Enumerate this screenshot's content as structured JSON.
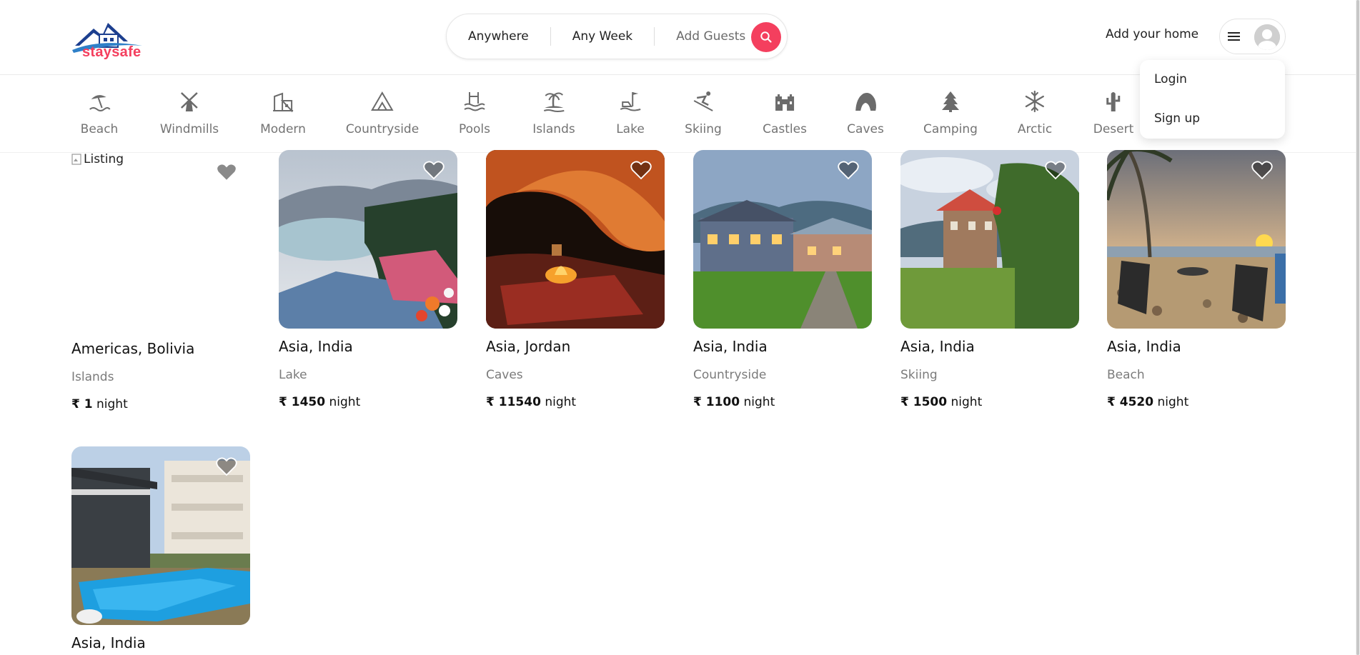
{
  "brand": {
    "name": "staysafe",
    "accent": "#f43f5e"
  },
  "search": {
    "where": "Anywhere",
    "when": "Any Week",
    "who": "Add Guests"
  },
  "header": {
    "host_link": "Add your home"
  },
  "user_menu": {
    "items": [
      "Login",
      "Sign up"
    ]
  },
  "categories": [
    {
      "label": "Beach",
      "icon": "beach-icon"
    },
    {
      "label": "Windmills",
      "icon": "windmill-icon"
    },
    {
      "label": "Modern",
      "icon": "modern-building-icon"
    },
    {
      "label": "Countryside",
      "icon": "mountain-icon"
    },
    {
      "label": "Pools",
      "icon": "pool-icon"
    },
    {
      "label": "Islands",
      "icon": "island-icon"
    },
    {
      "label": "Lake",
      "icon": "lake-icon"
    },
    {
      "label": "Skiing",
      "icon": "skiing-icon"
    },
    {
      "label": "Castles",
      "icon": "castle-icon"
    },
    {
      "label": "Caves",
      "icon": "cave-icon"
    },
    {
      "label": "Camping",
      "icon": "camping-icon"
    },
    {
      "label": "Arctic",
      "icon": "snowflake-icon"
    },
    {
      "label": "Desert",
      "icon": "cactus-icon"
    }
  ],
  "listings": [
    {
      "location": "Americas, Bolivia",
      "category": "Islands",
      "currency": "₹",
      "price": "1",
      "unit": "night",
      "image_alt": "Listing"
    },
    {
      "location": "Asia, India",
      "category": "Lake",
      "currency": "₹",
      "price": "1450",
      "unit": "night"
    },
    {
      "location": "Asia, Jordan",
      "category": "Caves",
      "currency": "₹",
      "price": "11540",
      "unit": "night"
    },
    {
      "location": "Asia, India",
      "category": "Countryside",
      "currency": "₹",
      "price": "1100",
      "unit": "night"
    },
    {
      "location": "Asia, India",
      "category": "Skiing",
      "currency": "₹",
      "price": "1500",
      "unit": "night"
    },
    {
      "location": "Asia, India",
      "category": "Beach",
      "currency": "₹",
      "price": "4520",
      "unit": "night"
    },
    {
      "location": "Asia, India",
      "category": "",
      "currency": "",
      "price": "",
      "unit": ""
    }
  ]
}
